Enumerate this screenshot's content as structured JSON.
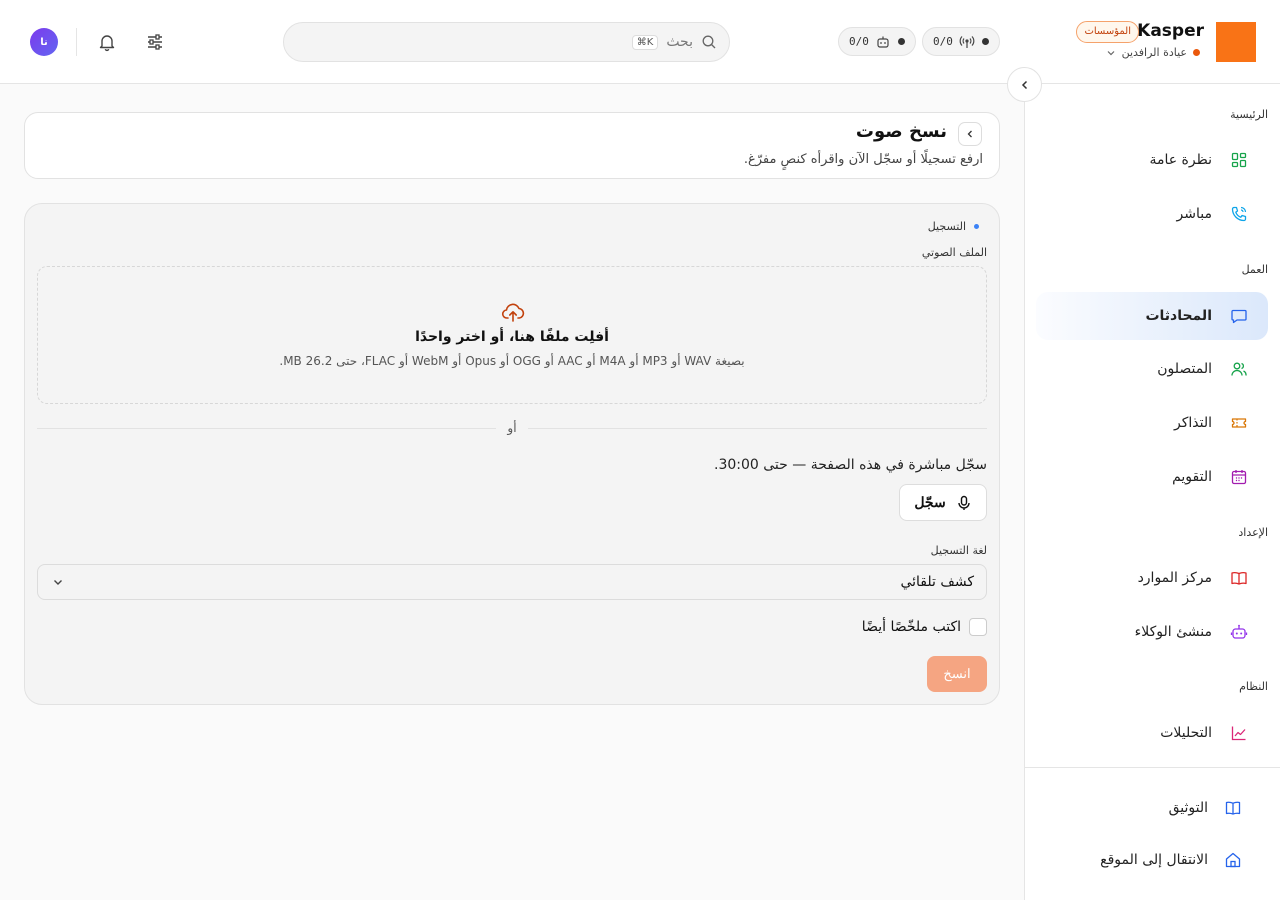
{
  "header": {
    "brand_name": "Kasper",
    "brand_badge": "المؤسسات",
    "workspace_name": "عيادة الرافدين",
    "counter_1": "0/0",
    "counter_2": "0/0",
    "search_placeholder": "بحث",
    "search_shortcut": "⌘K",
    "avatar_initials": "نا",
    "colors": {
      "brand": "#f97316",
      "status": "#ea580c",
      "avatar": "#7c3aed"
    }
  },
  "sidebar": {
    "sections": [
      {
        "title": "الرئيسية",
        "items": [
          {
            "label": "نظرة عامة",
            "icon": "grid-icon"
          },
          {
            "label": "مباشر",
            "icon": "phone-icon"
          }
        ]
      },
      {
        "title": "العمل",
        "items": [
          {
            "label": "المحادثات",
            "icon": "chat-icon",
            "active": true
          },
          {
            "label": "المتصلون",
            "icon": "users-icon"
          },
          {
            "label": "التذاكر",
            "icon": "ticket-icon"
          },
          {
            "label": "التقويم",
            "icon": "calendar-icon"
          }
        ]
      },
      {
        "title": "الإعداد",
        "items": [
          {
            "label": "مركز الموارد",
            "icon": "book-icon"
          },
          {
            "label": "منشئ الوكلاء",
            "icon": "bot-icon"
          }
        ]
      },
      {
        "title": "النظام",
        "items": [
          {
            "label": "التحليلات",
            "icon": "chart-icon"
          }
        ]
      }
    ],
    "footer": [
      {
        "label": "التوثيق",
        "icon": "docs-icon"
      },
      {
        "label": "الانتقال إلى الموقع",
        "icon": "home-icon"
      }
    ]
  },
  "page": {
    "title": "نسخ صوت",
    "subtitle": "ارفع تسجيلًا أو سجّل الآن واقرأه كنصٍ مفرّغ."
  },
  "form": {
    "step_label": "التسجيل",
    "audio_label": "الملف الصوتي",
    "drop_title": "أفلِت ملفًا هنا، أو اختر واحدًا",
    "drop_hint": "بصيغة WAV أو MP3 أو M4A أو AAC أو OGG أو Opus أو WebM أو FLAC، حتى 26.2 MB.",
    "or_text": "أو",
    "record_note": "سجّل مباشرة في هذه الصفحة — حتى 30:00.",
    "record_button": "سجّل",
    "language_label": "لغة التسجيل",
    "language_value": "كشف تلقائي",
    "summary_checkbox": "اكتب ملخّصًا أيضًا",
    "submit_button": "انسخ"
  }
}
